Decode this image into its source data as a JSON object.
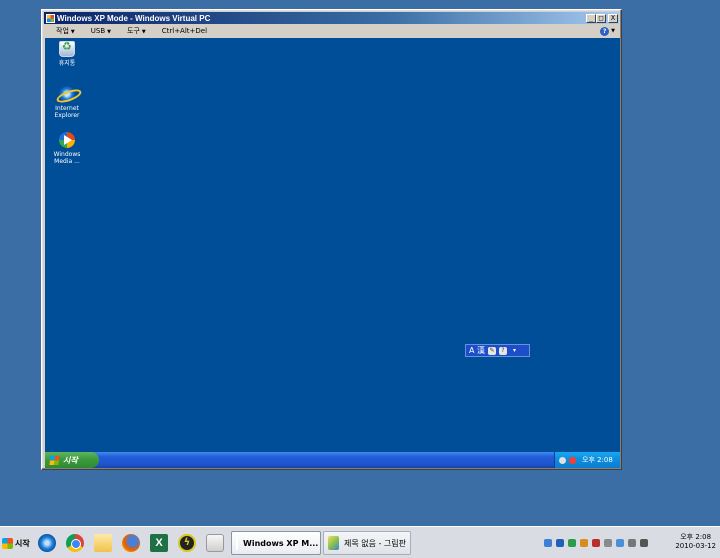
{
  "window": {
    "title": "Windows XP Mode - Windows Virtual PC",
    "minimize": "_",
    "maximize": "□",
    "close": "X"
  },
  "menubar": {
    "items": [
      {
        "label": "작업"
      },
      {
        "label": "USB"
      },
      {
        "label": "도구"
      },
      {
        "label": "Ctrl+Alt+Del"
      }
    ]
  },
  "guest_desktop": {
    "icons": [
      {
        "label": "휴지통",
        "icon": "recycle-bin-icon"
      },
      {
        "label": "Internet Explorer",
        "icon": "internet-explorer-icon"
      },
      {
        "label": "Windows Media ...",
        "icon": "windows-media-player-icon"
      }
    ],
    "ime_bar": {
      "label": "A 漢"
    },
    "taskbar": {
      "start_label": "시작",
      "clock": "오후 2:08"
    }
  },
  "host_taskbar": {
    "start_label": "시작",
    "tasks": [
      {
        "label": "Windows XP M..."
      },
      {
        "label": "제목 없음 - 그림판"
      }
    ],
    "clock_time": "오후 2:08",
    "clock_date": "2010-03-12"
  }
}
